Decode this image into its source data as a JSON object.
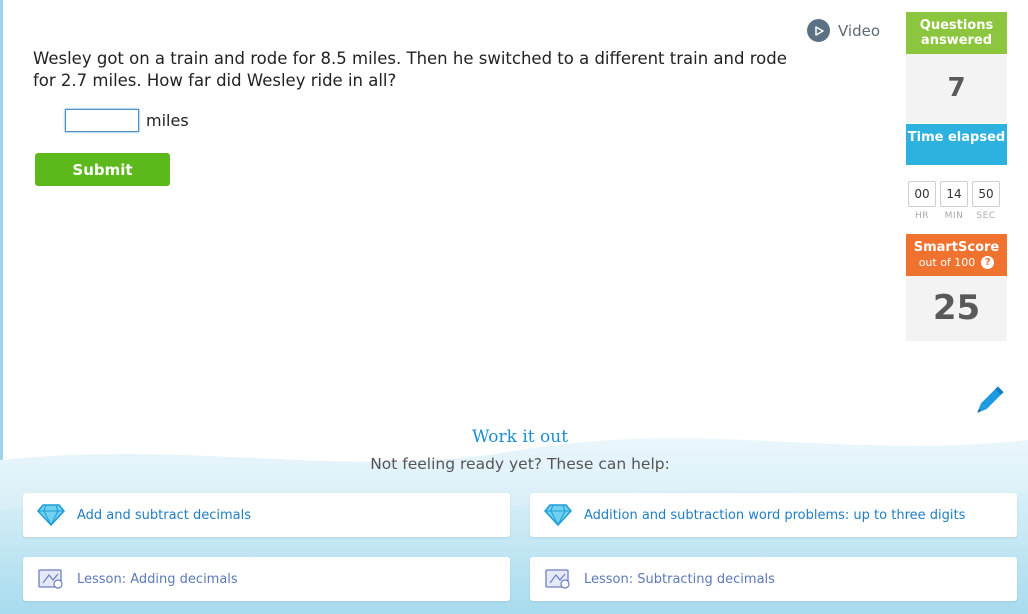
{
  "question": {
    "text": "Wesley got on a train and rode for 8.5 miles. Then he switched to a different train and rode for 2.7 miles. How far did Wesley ride in all?",
    "answer_value": "",
    "unit": "miles",
    "submit_label": "Submit"
  },
  "video": {
    "label": "Video",
    "icon": "play-circle-icon"
  },
  "sidebar": {
    "questions_answered_label": "Questions answered",
    "questions_answered_value": "7",
    "time_elapsed_label": "Time elapsed",
    "timer": {
      "hr": "00",
      "min": "14",
      "sec": "50",
      "hr_label": "HR",
      "min_label": "MIN",
      "sec_label": "SEC"
    },
    "smartscore_label": "SmartScore",
    "smartscore_sub": "out of 100",
    "smartscore_value": "25",
    "colors": {
      "questions": "#8cc63f",
      "time": "#2db2e0",
      "smartscore": "#f0722f"
    }
  },
  "work_it_out": {
    "title": "Work it out",
    "subtitle": "Not feeling ready yet? These can help:",
    "items": [
      {
        "label": "Add and subtract decimals",
        "icon": "diamond-icon"
      },
      {
        "label": "Addition and subtraction word problems: up to three digits",
        "icon": "diamond-icon"
      },
      {
        "label": "Lesson: Adding decimals",
        "icon": "lesson-icon"
      },
      {
        "label": "Lesson: Subtracting decimals",
        "icon": "lesson-icon"
      }
    ]
  }
}
